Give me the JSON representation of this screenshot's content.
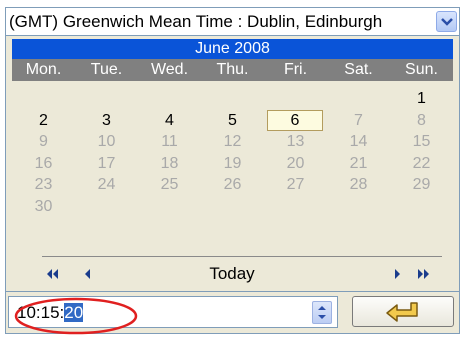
{
  "timezone": {
    "selected": "(GMT) Greenwich Mean Time : Dublin, Edinburgh"
  },
  "calendar": {
    "month_year": "June 2008",
    "weekdays": [
      "Mon.",
      "Tue.",
      "Wed.",
      "Thu.",
      "Fri.",
      "Sat.",
      "Sun."
    ],
    "weeks": [
      [
        "",
        "",
        "",
        "",
        "",
        "",
        "1"
      ],
      [
        "2",
        "3",
        "4",
        "5",
        "6",
        "7",
        "8"
      ],
      [
        "9",
        "10",
        "11",
        "12",
        "13",
        "14",
        "15"
      ],
      [
        "16",
        "17",
        "18",
        "19",
        "20",
        "21",
        "22"
      ],
      [
        "23",
        "24",
        "25",
        "26",
        "27",
        "28",
        "29"
      ],
      [
        "30",
        "",
        "",
        "",
        "",
        "",
        ""
      ]
    ],
    "enabled_days": [
      "1",
      "2",
      "3",
      "4",
      "5",
      "6"
    ],
    "today_day": "6",
    "today_label": "Today"
  },
  "time": {
    "prefix": "10:15:",
    "selected_part": "20"
  },
  "colors": {
    "title_bar": "#0a54d8",
    "weekday_bar": "#808080",
    "panel": "#ece9d8",
    "highlight_ring": "#e02020"
  },
  "icons": {
    "dropdown": "chevron-down-icon",
    "prev_year": "double-left-arrow-icon",
    "prev_month": "left-arrow-icon",
    "next_month": "right-arrow-icon",
    "next_year": "double-right-arrow-icon",
    "spin": "spinner-icon",
    "enter": "enter-return-icon"
  }
}
